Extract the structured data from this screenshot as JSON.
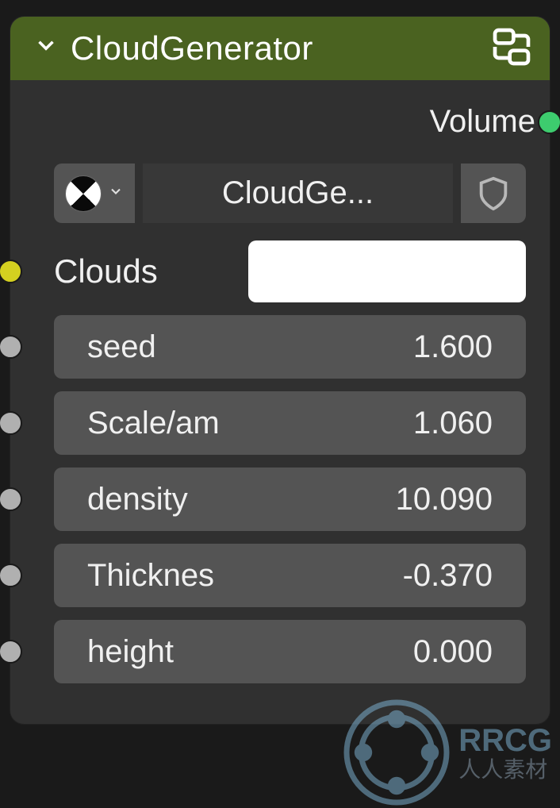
{
  "header": {
    "title": "CloudGenerator"
  },
  "output": {
    "label": "Volume"
  },
  "material": {
    "name": "CloudGe..."
  },
  "inputs": {
    "clouds": {
      "label": "Clouds",
      "color": "#ffffff"
    },
    "params": [
      {
        "label": "seed",
        "value": "1.600"
      },
      {
        "label": "Scale/am",
        "value": "1.060"
      },
      {
        "label": "density",
        "value": "10.090"
      },
      {
        "label": "Thicknes",
        "value": "-0.370"
      },
      {
        "label": "height",
        "value": "0.000"
      }
    ]
  },
  "watermark": {
    "brand": "RRCG",
    "sub": "人人素材"
  }
}
